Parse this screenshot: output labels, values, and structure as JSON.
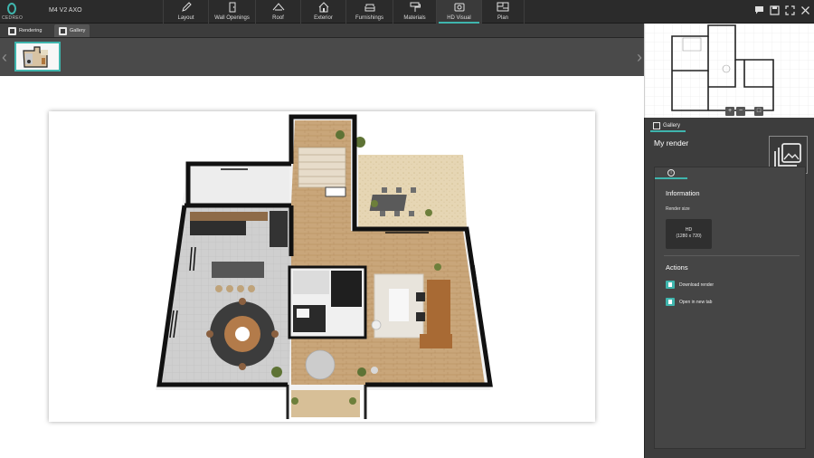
{
  "app": {
    "logo_text": "CEDREO",
    "project_name": "M4 V2 AXO"
  },
  "toolbar": {
    "tabs": [
      {
        "label": "Layout",
        "icon": "pencil-icon"
      },
      {
        "label": "Wall Openings",
        "icon": "door-icon"
      },
      {
        "label": "Roof",
        "icon": "roof-icon"
      },
      {
        "label": "Exterior",
        "icon": "house-icon"
      },
      {
        "label": "Furnishings",
        "icon": "sofa-icon"
      },
      {
        "label": "Materials",
        "icon": "paint-roller-icon"
      },
      {
        "label": "HD Visual",
        "icon": "camera-icon",
        "active": true
      },
      {
        "label": "Plan",
        "icon": "plan-icon"
      }
    ],
    "window_icons": [
      "chat-icon",
      "save-icon",
      "fullscreen-icon",
      "close-icon"
    ]
  },
  "subbar": {
    "rendering_label": "Rendering",
    "gallery_label": "Gallery"
  },
  "panel": {
    "tab_label": "Gallery",
    "title": "My render",
    "info_title": "Information",
    "render_size_label": "Render size",
    "render_size_value": "HD",
    "render_size_dims": "(1280 x 720)",
    "actions_title": "Actions",
    "download_label": "Download render",
    "newtab_label": "Open in new tab"
  },
  "colors": {
    "accent": "#3fb5ad",
    "toolbar_bg": "#2b2b2b",
    "panel_bg": "#3d3d3d"
  }
}
